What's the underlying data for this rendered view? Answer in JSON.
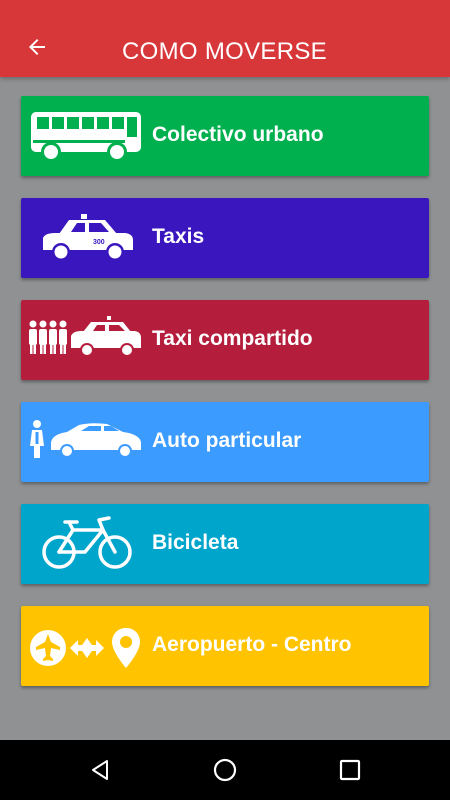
{
  "appbar": {
    "title": "COMO MOVERSE",
    "back_icon": "arrow-left-icon"
  },
  "items": [
    {
      "label": "Colectivo urbano",
      "color": "#00af4e",
      "icon": "bus-icon"
    },
    {
      "label": "Taxis",
      "color": "#3a16bf",
      "icon": "taxi-icon"
    },
    {
      "label": "Taxi compartido",
      "color": "#b41e3c",
      "icon": "shared-taxi-icon"
    },
    {
      "label": "Auto particular",
      "color": "#3c9bff",
      "icon": "private-car-icon"
    },
    {
      "label": "Bicicleta",
      "color": "#00a5cc",
      "icon": "bicycle-icon"
    },
    {
      "label": "Aeropuerto - Centro",
      "color": "#ffc300",
      "icon": "airport-to-center-icon"
    }
  ],
  "navbar": {
    "back": "nav-back-icon",
    "home": "nav-home-icon",
    "recents": "nav-recents-icon"
  }
}
